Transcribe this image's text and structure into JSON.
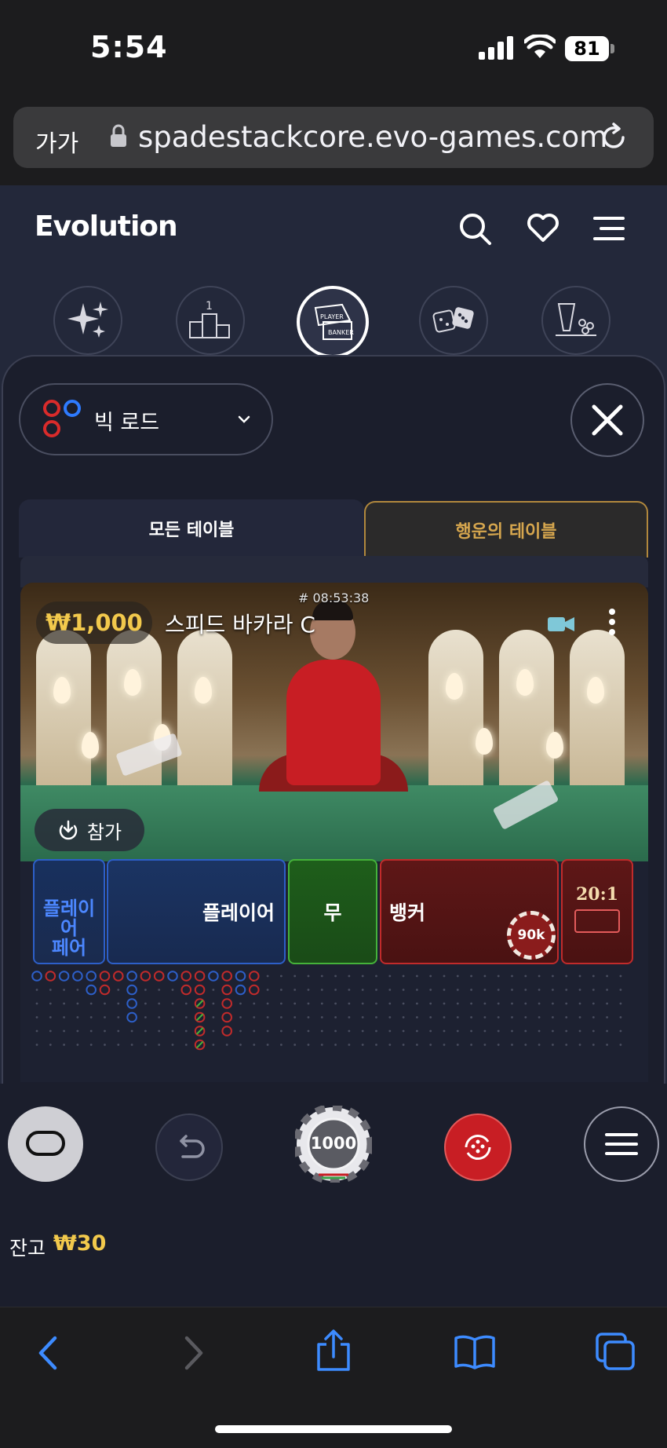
{
  "status_bar": {
    "time": "5:54",
    "battery": "81"
  },
  "browser": {
    "text_size": "가가",
    "url": "spadestackcore.evo-games.com"
  },
  "header": {
    "logo": "Evolution"
  },
  "categories": [
    "sparkle-icon",
    "podium-icon",
    "baccarat-icon",
    "dice-icon",
    "roulette-icon"
  ],
  "filter": {
    "selected": "빅 로드"
  },
  "tabs": {
    "all": "모든 테이블",
    "lucky": "행운의 테이블"
  },
  "table": {
    "stake": "₩1,000",
    "name": "스피드 바카라 C",
    "round_id": "# 08:53:38",
    "join": "참가",
    "bets": {
      "player_pair": "플레이\n어\n페어",
      "player": "플레이어",
      "tie": "무",
      "banker": "뱅커",
      "side_odds": "20:1",
      "banker_chip": "90k"
    },
    "colors": {
      "player": "#2d5fc8",
      "tie": "#45b23a",
      "banker": "#c12b2b"
    }
  },
  "controls": {
    "chip_value": "1000"
  },
  "balance": {
    "label": "잔고",
    "value": "₩30"
  }
}
